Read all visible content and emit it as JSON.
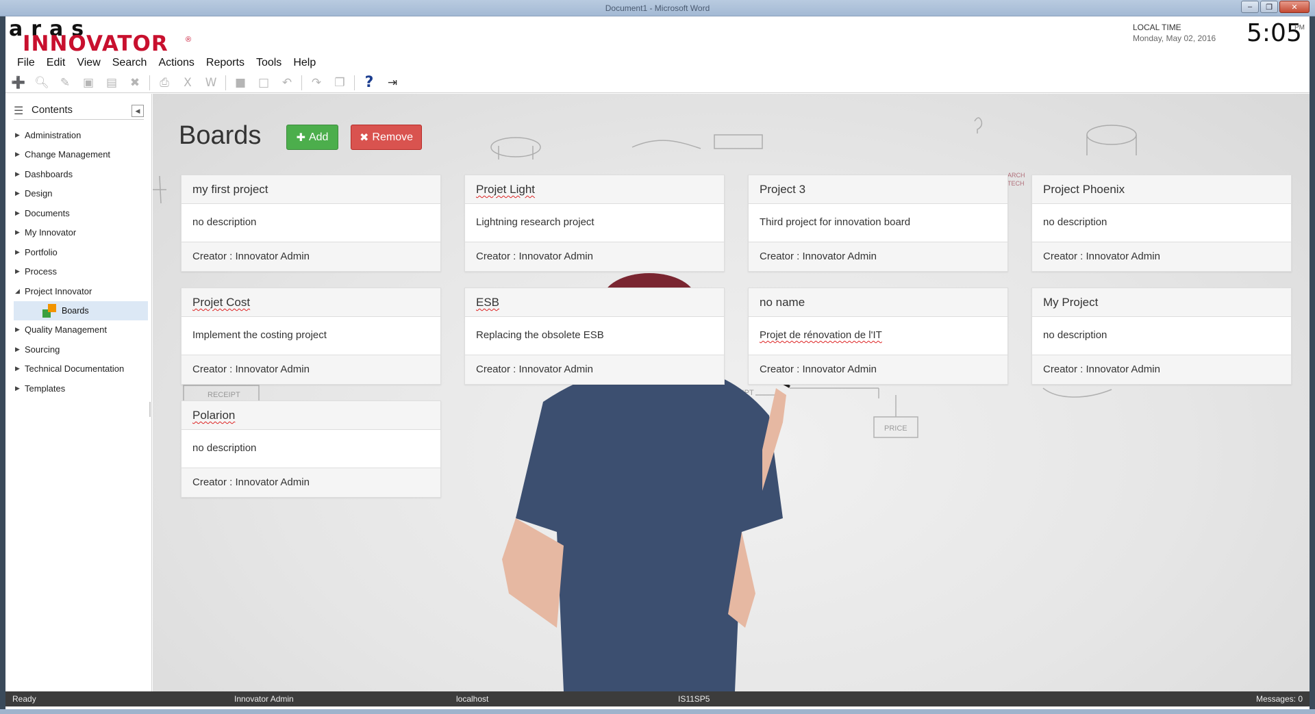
{
  "window": {
    "title": "Document1 - Microsoft Word",
    "controls": [
      "minimize",
      "maximize",
      "close"
    ]
  },
  "brand": {
    "top": "aras",
    "main": "INNOVATOR",
    "reg": "®"
  },
  "clock": {
    "label": "LOCAL TIME",
    "date": "Monday, May 02, 2016",
    "time": "5:05",
    "ampm": "PM"
  },
  "menu": [
    "File",
    "Edit",
    "View",
    "Search",
    "Actions",
    "Reports",
    "Tools",
    "Help"
  ],
  "toolbar": {
    "new": "new-item",
    "view": "view-item",
    "edit": "edit-item",
    "save": "save-item",
    "save_unlock": "save-unlock-item",
    "delete": "delete-item",
    "print": "print",
    "excel": "export-excel",
    "word": "export-word",
    "lock": "lock",
    "unlock": "unlock",
    "undo": "undo",
    "promote": "promote",
    "copy": "copy",
    "help": "?",
    "logout": "logout"
  },
  "sidebar": {
    "title": "Contents",
    "items": [
      {
        "label": "Administration",
        "expanded": false
      },
      {
        "label": "Change Management",
        "expanded": false
      },
      {
        "label": "Dashboards",
        "expanded": false
      },
      {
        "label": "Design",
        "expanded": false
      },
      {
        "label": "Documents",
        "expanded": false
      },
      {
        "label": "My Innovator",
        "expanded": false
      },
      {
        "label": "Portfolio",
        "expanded": false
      },
      {
        "label": "Process",
        "expanded": false
      },
      {
        "label": "Project Innovator",
        "expanded": true
      },
      {
        "label": "Quality Management",
        "expanded": false
      },
      {
        "label": "Sourcing",
        "expanded": false
      },
      {
        "label": "Technical Documentation",
        "expanded": false
      },
      {
        "label": "Templates",
        "expanded": false
      }
    ],
    "selected_child": "Boards"
  },
  "page": {
    "title": "Boards",
    "add_label": "Add",
    "remove_label": "Remove"
  },
  "boards": [
    {
      "title": "my first project",
      "description": "no description",
      "creator": "Creator : Innovator Admin"
    },
    {
      "title": "Projet Light",
      "description": "Lightning research project",
      "creator": "Creator : Innovator Admin"
    },
    {
      "title": "Project 3",
      "description": "Third project for innovation board",
      "creator": "Creator : Innovator Admin"
    },
    {
      "title": "Project Phoenix",
      "description": "no description",
      "creator": "Creator : Innovator Admin"
    },
    {
      "title": "Projet Cost",
      "description": "Implement the costing project",
      "creator": "Creator : Innovator Admin"
    },
    {
      "title": "ESB",
      "description": "Replacing the obsolete ESB",
      "creator": "Creator : Innovator Admin"
    },
    {
      "title": "no name",
      "description": "Projet de rénovation de l'IT",
      "creator": "Creator : Innovator Admin"
    },
    {
      "title": "My Project",
      "description": "no description",
      "creator": "Creator : Innovator Admin"
    },
    {
      "title": "Polarion",
      "description": "no description",
      "creator": "Creator : Innovator Admin"
    }
  ],
  "status": {
    "state": "Ready",
    "user": "Innovator Admin",
    "server": "localhost",
    "db": "IS11SP5",
    "messages": "Messages: 0"
  },
  "colors": {
    "brand_red": "#c8102e",
    "add_green": "#4cae4c",
    "remove_red": "#d9534f",
    "status_bg": "#3c3c3c",
    "selection": "#dce8f5"
  }
}
